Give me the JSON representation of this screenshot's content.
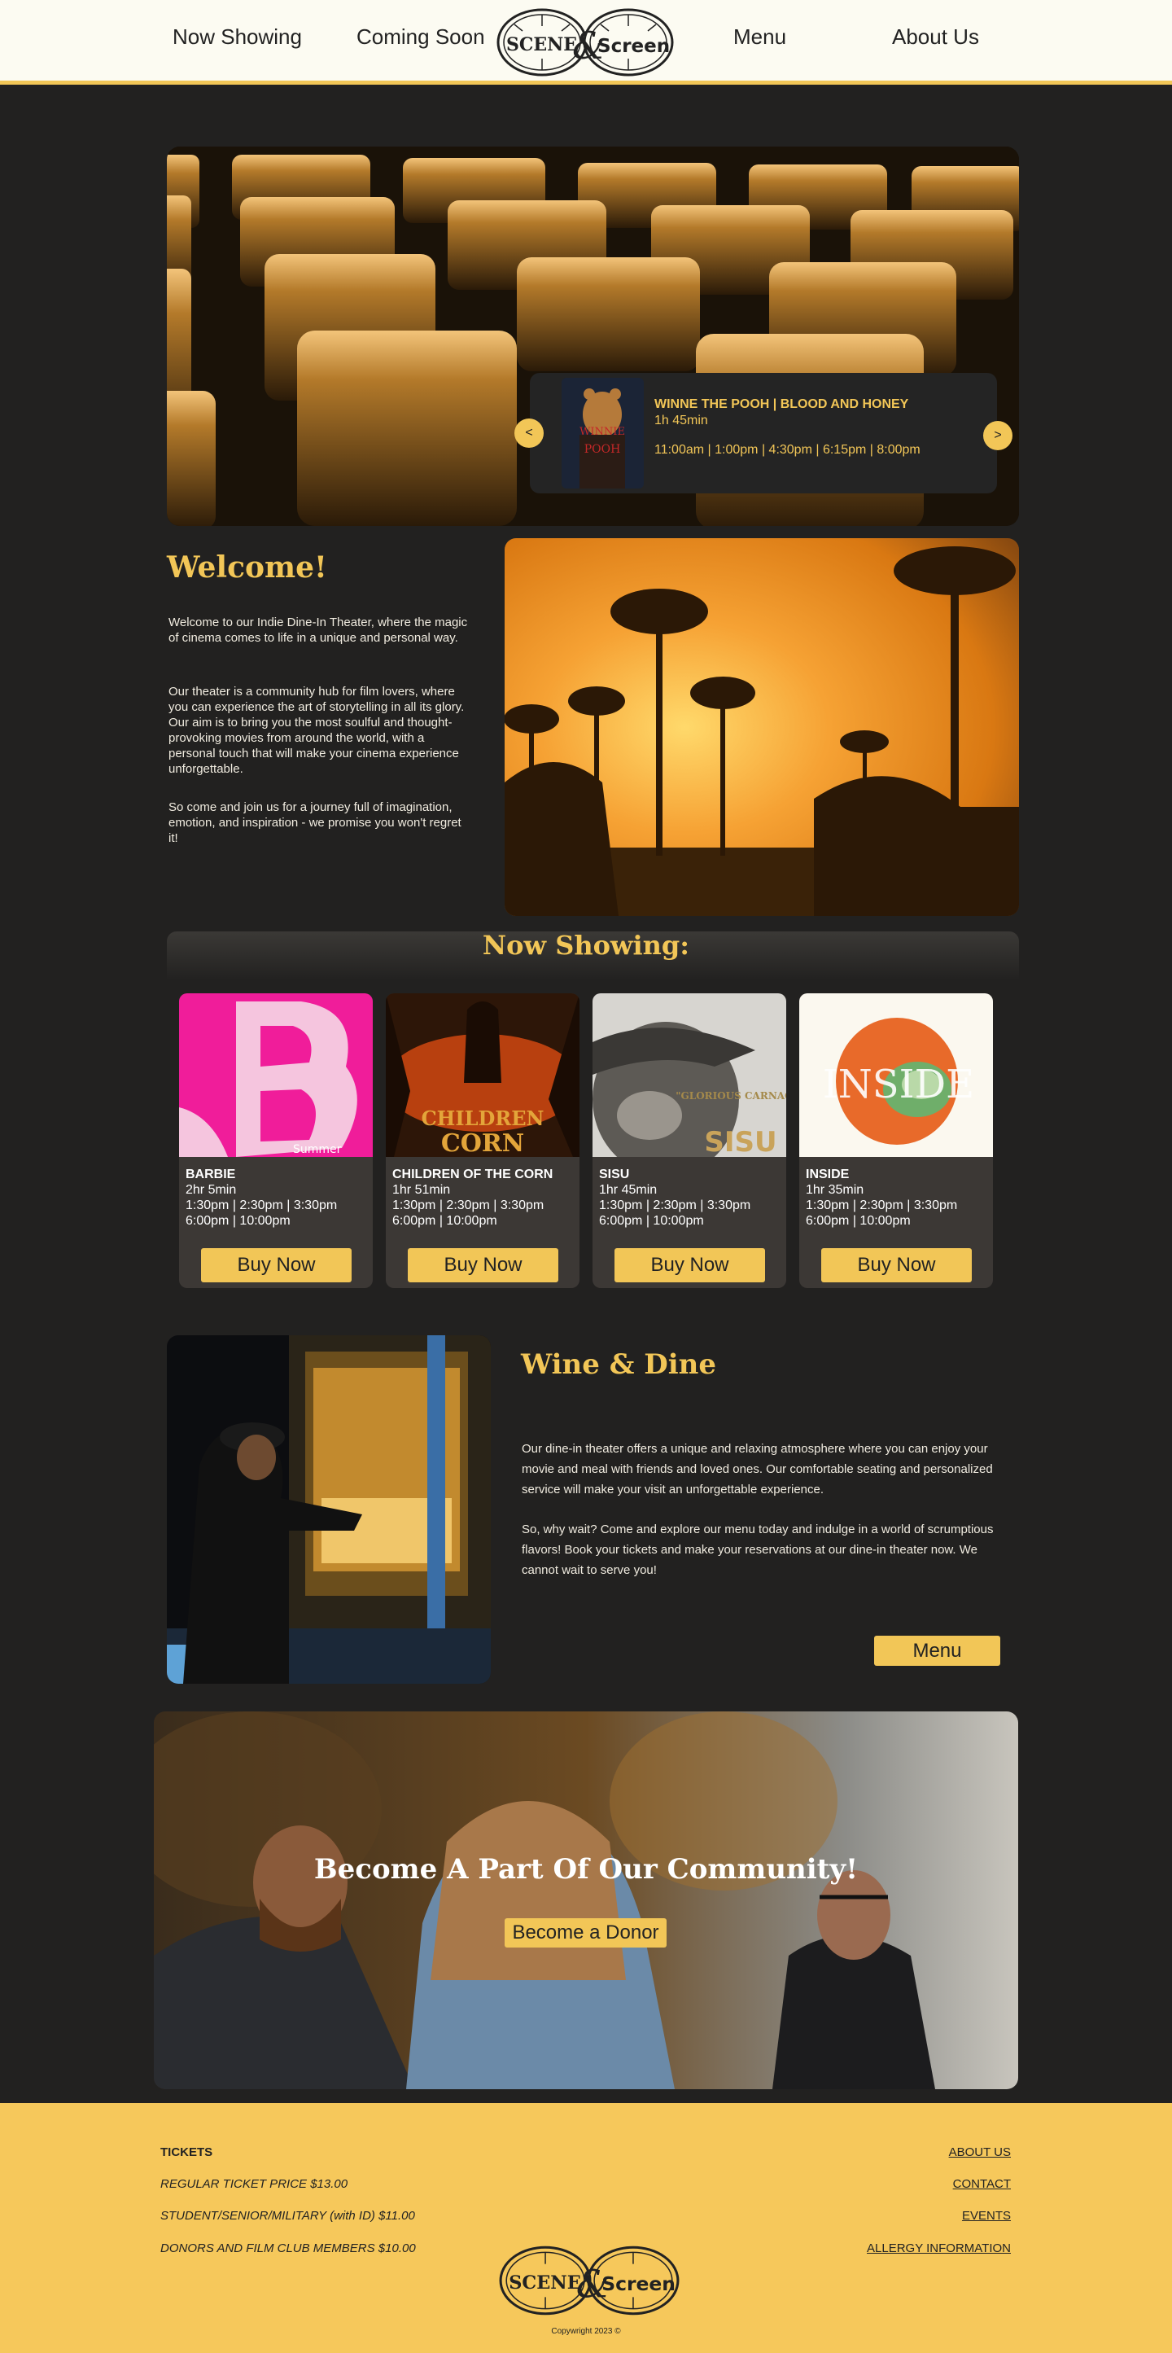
{
  "nav": {
    "links": [
      "Now Showing",
      "Coming Soon",
      "Menu",
      "About Us"
    ],
    "logo_text_left": "SCENE",
    "logo_text_amp": "&",
    "logo_text_right": "Screen"
  },
  "hero": {
    "featured": {
      "title": "WINNE THE POOH | BLOOD AND HONEY",
      "runtime": "1h 45min",
      "times": "11:00am | 1:00pm | 4:30pm | 6:15pm | 8:00pm",
      "poster_text_1": "WINNIE",
      "poster_text_2": "POOH"
    },
    "prev_label": "<",
    "next_label": ">"
  },
  "welcome": {
    "title": "Welcome!",
    "p1": "Welcome to our Indie Dine-In Theater, where the magic of cinema comes to life in a unique and personal way.",
    "p2": "Our theater is a community hub for film lovers, where you can experience the art of storytelling in all its glory.  Our aim is to bring you the most soulful and thought-provoking movies from around the world, with a personal touch that will make your cinema experience unforgettable.",
    "p3": "So come and join us for a journey full of imagination, emotion, and inspiration - we promise you won't regret it!"
  },
  "now_showing": {
    "title": "Now Showing:",
    "buy_label": "Buy Now",
    "movies": [
      {
        "title": "BARBIE",
        "runtime": "2hr 5min",
        "times1": "1:30pm | 2:30pm | 3:30pm",
        "times2": "6:00pm | 10:00pm",
        "poster_text": "Summer"
      },
      {
        "title": "CHILDREN OF THE CORN",
        "runtime": "1hr 51min",
        "times1": "1:30pm | 2:30pm | 3:30pm",
        "times2": "6:00pm | 10:00pm",
        "poster_text_1": "CHILDREN",
        "poster_text_2": "CORN"
      },
      {
        "title": "SISU",
        "runtime": "1hr 45min",
        "times1": "1:30pm | 2:30pm | 3:30pm",
        "times2": "6:00pm | 10:00pm",
        "poster_text_1": "\"GLORIOUS CARNAGE\"",
        "poster_text_2": "SISU"
      },
      {
        "title": "INSIDE",
        "runtime": "1hr 35min",
        "times1": "1:30pm | 2:30pm | 3:30pm",
        "times2": "6:00pm | 10:00pm",
        "poster_text": "INSIDE"
      }
    ]
  },
  "wine_dine": {
    "title": "Wine & Dine",
    "p1": "Our dine-in theater offers a unique and relaxing atmosphere where you can enjoy your movie and meal with friends and loved ones. Our comfortable seating and personalized service will make your visit an unforgettable experience.",
    "p2": "So, why wait? Come and explore our menu today and indulge in a world of scrumptious flavors! Book your tickets and make your reservations at our dine-in theater now. We cannot wait to serve you!",
    "menu_label": "Menu"
  },
  "community": {
    "title": "Become A Part Of Our Community!",
    "donor_label": "Become a Donor"
  },
  "footer": {
    "tickets_title": "TICKETS",
    "prices": [
      "REGULAR TICKET PRICE $13.00",
      "STUDENT/SENIOR/MILITARY (with ID) $11.00",
      "DONORS AND FILM CLUB MEMBERS $10.00"
    ],
    "links": [
      "ABOUT US",
      "CONTACT",
      "EVENTS",
      "ALLERGY INFORMATION"
    ],
    "copyright": "Copywright 2023 ©"
  },
  "colors": {
    "accent": "#f2c657",
    "background": "#222120",
    "card": "#3c3835",
    "footer": "#f6c85b"
  }
}
